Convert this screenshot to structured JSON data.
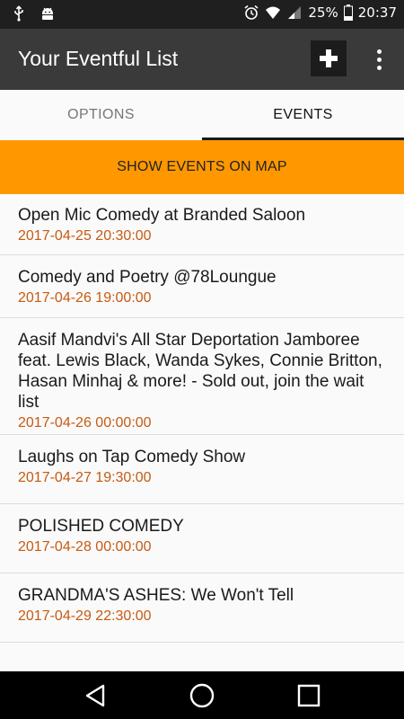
{
  "status_bar": {
    "battery": "25%",
    "time": "20:37"
  },
  "app_bar": {
    "title": "Your Eventful List"
  },
  "tabs": [
    {
      "label": "OPTIONS",
      "selected": false
    },
    {
      "label": "EVENTS",
      "selected": true
    }
  ],
  "map_button": {
    "label": "SHOW EVENTS ON MAP",
    "color": "#ff9800"
  },
  "events": [
    {
      "title": "Open Mic Comedy at Branded Saloon",
      "date": "2017-04-25 20:30:00"
    },
    {
      "title": "Comedy and Poetry @78Loungue",
      "date": "2017-04-26 19:00:00"
    },
    {
      "title": "Aasif Mandvi's All Star Deportation Jamboree feat. Lewis Black, Wanda Sykes, Connie Britton, Hasan Minhaj & more! - Sold out, join the wait list",
      "date": "2017-04-26 00:00:00"
    },
    {
      "title": "Laughs on Tap Comedy Show",
      "date": "2017-04-27 19:30:00"
    },
    {
      "title": "POLISHED COMEDY",
      "date": "2017-04-28 00:00:00"
    },
    {
      "title": "GRANDMA'S ASHES: We Won't Tell",
      "date": "2017-04-29 22:30:00"
    }
  ],
  "colors": {
    "date_text": "#c65a12",
    "app_bar": "#3a3a3a",
    "accent": "#ff9800"
  }
}
